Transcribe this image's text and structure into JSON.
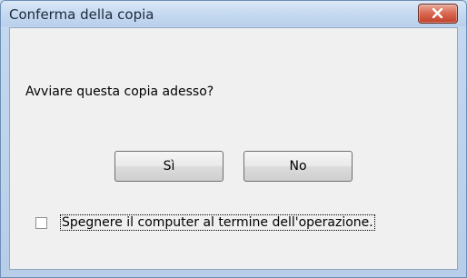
{
  "window": {
    "title": "Conferma della copia",
    "close_icon": "close-icon"
  },
  "dialog": {
    "message": "Avviare questa copia adesso?",
    "yes_label": "Sì",
    "no_label": "No",
    "shutdown_checkbox": {
      "label": "Spegnere il computer al termine dell'operazione.",
      "checked": false
    }
  },
  "colors": {
    "frame": "#c5d9ef",
    "client": "#f0f0f0",
    "close_button": "#c7513a"
  }
}
